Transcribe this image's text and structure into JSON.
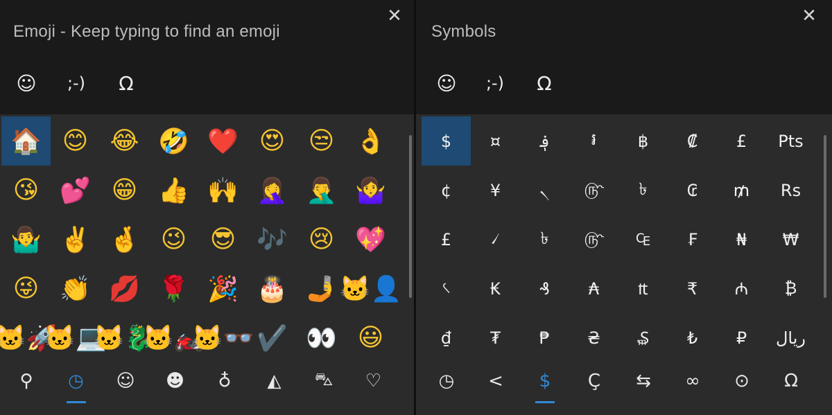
{
  "colors": {
    "accent": "#2f8ad8",
    "selected_bg": "#1e4a74",
    "panel_bg": "#2b2b2b",
    "header_bg": "#1a1a1a"
  },
  "close_glyph": "✕",
  "emoji_panel": {
    "title": "Emoji - Keep typing to find an emoji",
    "tabs": [
      {
        "icon": "smiley-face-icon",
        "glyph": "☺",
        "active": true
      },
      {
        "icon": "kaomoji-icon",
        "glyph": ";-)",
        "active": false
      },
      {
        "icon": "omega-symbol-icon",
        "glyph": "Ω",
        "active": false
      }
    ],
    "grid": [
      "🏠",
      "😊",
      "😂",
      "🤣",
      "❤️",
      "😍",
      "😒",
      "👌",
      "😘",
      "💕",
      "😁",
      "👍",
      "🙌",
      "🤦‍♀️",
      "🤦‍♂️",
      "🤷‍♀️",
      "🤷‍♂️",
      "✌️",
      "🤞",
      "😉",
      "😎",
      "🎶",
      "😢",
      "💖",
      "😜",
      "👏",
      "💋",
      "🌹",
      "🎉",
      "🎂",
      "🤳",
      "🐱‍👤",
      "🐱‍🚀",
      "🐱‍💻",
      "🐱‍🐉",
      "🐱‍🏍",
      "🐱‍👓",
      "✔️",
      "👀",
      "😃"
    ],
    "bottom_tabs": [
      {
        "icon": "search-icon",
        "glyph": "⚲",
        "active": false
      },
      {
        "icon": "recent-clock-icon",
        "glyph": "◷",
        "active": true
      },
      {
        "icon": "smiley-face-icon",
        "glyph": "☺",
        "active": false
      },
      {
        "icon": "people-icon",
        "glyph": "☻",
        "active": false
      },
      {
        "icon": "balloon-icon",
        "glyph": "♁",
        "active": false
      },
      {
        "icon": "pizza-icon",
        "glyph": "◭",
        "active": false
      },
      {
        "icon": "car-icon",
        "glyph": "⛍",
        "active": false
      },
      {
        "icon": "heart-icon",
        "glyph": "♡",
        "active": false
      }
    ]
  },
  "symbols_panel": {
    "title": "Symbols",
    "tabs": [
      {
        "icon": "smiley-face-icon",
        "glyph": "☺",
        "active": false
      },
      {
        "icon": "kaomoji-icon",
        "glyph": ";-)",
        "active": false
      },
      {
        "icon": "omega-symbol-icon",
        "glyph": "Ω",
        "active": true
      }
    ],
    "grid": [
      "$",
      "¤",
      "؋",
      "៛",
      "฿",
      "₡",
      "£",
      "Pts",
      "¢",
      "¥",
      "৲",
      "௹",
      "৳",
      "₢",
      "₥",
      "Rs",
      "£",
      "৴",
      "৳",
      "௹",
      "₠",
      "₣",
      "₦",
      "₩",
      "৻",
      "₭",
      "₰",
      "₳",
      "₶",
      "₹",
      "₼",
      "₿",
      "₫",
      "₮",
      "₱",
      "₴",
      "₷",
      "₺",
      "₽",
      "ریال"
    ],
    "bottom_tabs": [
      {
        "icon": "recent-clock-icon",
        "glyph": "◷",
        "active": false
      },
      {
        "icon": "less-than-icon",
        "glyph": "<",
        "active": false
      },
      {
        "icon": "dollar-currency-icon",
        "glyph": "$",
        "active": true
      },
      {
        "icon": "c-cedilla-icon",
        "glyph": "Ç",
        "active": false
      },
      {
        "icon": "arrows-icon",
        "glyph": "⇆",
        "active": false
      },
      {
        "icon": "infinity-icon",
        "glyph": "∞",
        "active": false
      },
      {
        "icon": "circled-dot-icon",
        "glyph": "⊙",
        "active": false
      },
      {
        "icon": "omega-symbol-icon",
        "glyph": "Ω",
        "active": false
      }
    ]
  }
}
